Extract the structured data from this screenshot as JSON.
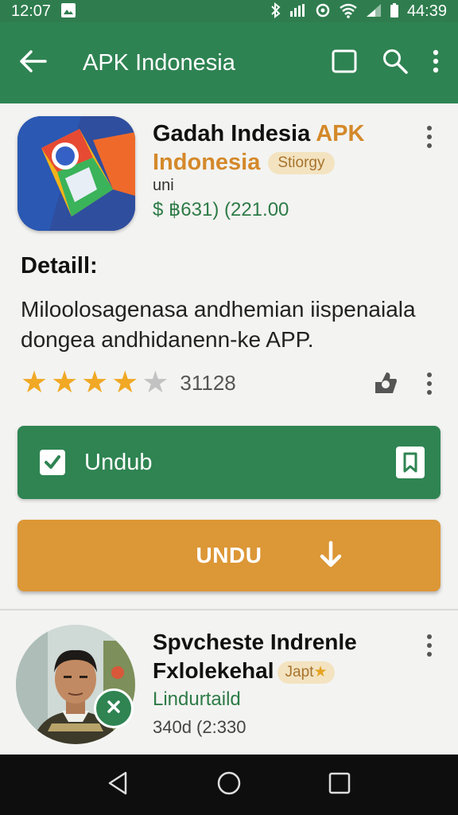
{
  "status": {
    "time": "12:07",
    "battery": "44:39"
  },
  "appbar": {
    "title": "APK Indonesia"
  },
  "app": {
    "title_black": "Gadah Indesia",
    "title_accent_1": "APK",
    "title_accent_2": "Indonesia",
    "tag": "Stiorgy",
    "subtitle": "uni",
    "price": "$ ฿631) (221.00",
    "detail_heading": "Detaill:",
    "detail_text": "Miloolosagenasa andhemian iispenaiala dongea andhidanenn-ke APP.",
    "rating_stars": 4,
    "rating_max": 5,
    "rating_count": "31128"
  },
  "buttons": {
    "primary_label": "Undub",
    "secondary_label": "UNDU"
  },
  "item2": {
    "title_line1": "Spvcheste Indrenle",
    "title_line2": "Fxlolekehal",
    "tag": "Japt",
    "subtitle": "Lindurtaild",
    "meta": "340d (2:330"
  },
  "colors": {
    "primary": "#2e8352",
    "accent": "#dc9736",
    "star": "#f0a825"
  },
  "icons": {
    "back": "arrow-left-icon",
    "square": "square-icon",
    "search": "search-icon",
    "more": "more-vert-icon",
    "bookmark": "bookmark-icon",
    "download": "download-arrow-icon",
    "close": "close-icon"
  }
}
